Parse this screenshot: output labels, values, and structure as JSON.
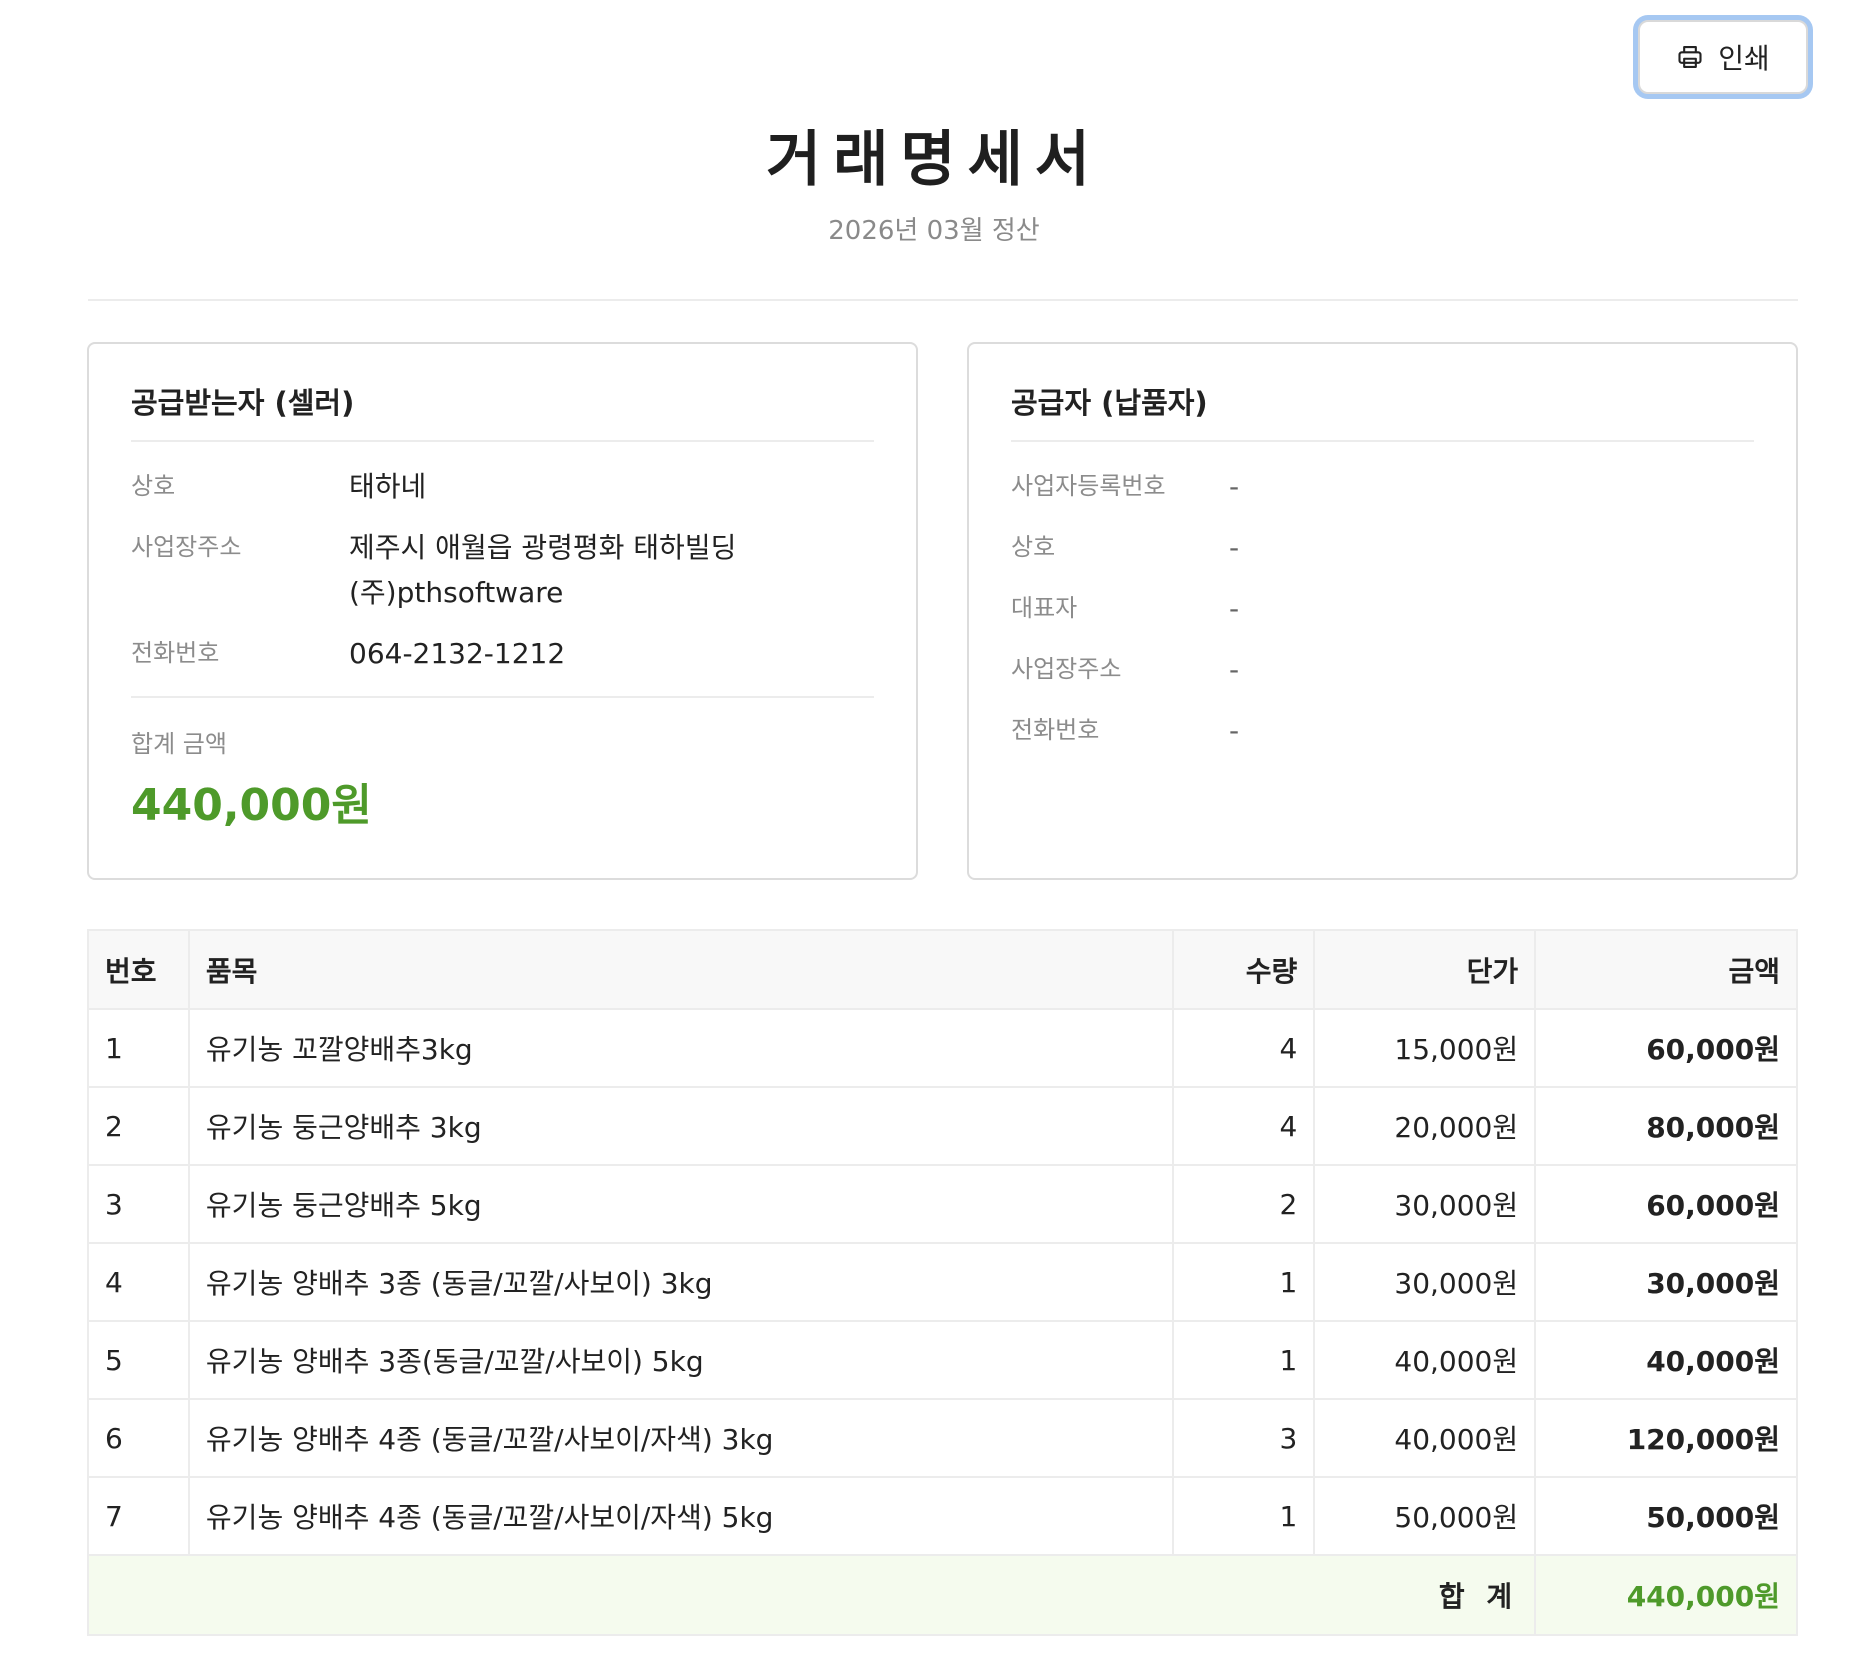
{
  "toolbar": {
    "print_label": "인쇄",
    "print_icon": "printer-icon"
  },
  "header": {
    "title": "거래명세서",
    "subtitle": "2026년 03월 정산"
  },
  "receiver": {
    "title": "공급받는자 (셀러)",
    "rows": [
      {
        "label": "상호",
        "value": "태하네"
      },
      {
        "label": "사업장주소",
        "value": "제주시 애월읍 광령평화 태하빌딩",
        "value2": "(주)pthsoftware"
      },
      {
        "label": "전화번호",
        "value": "064-2132-1212"
      }
    ],
    "total_label": "합계 금액",
    "total_amount": "440,000원"
  },
  "supplier": {
    "title": "공급자 (납품자)",
    "rows": [
      {
        "label": "사업자등록번호",
        "value": "-"
      },
      {
        "label": "상호",
        "value": "-"
      },
      {
        "label": "대표자",
        "value": "-"
      },
      {
        "label": "사업장주소",
        "value": "-"
      },
      {
        "label": "전화번호",
        "value": "-"
      }
    ]
  },
  "table": {
    "headers": [
      "번호",
      "품목",
      "수량",
      "단가",
      "금액"
    ],
    "rows": [
      {
        "no": "1",
        "item": "유기농 꼬깔양배추3kg",
        "qty": "4",
        "price": "15,000원",
        "amount": "60,000원"
      },
      {
        "no": "2",
        "item": "유기농 둥근양배추 3kg",
        "qty": "4",
        "price": "20,000원",
        "amount": "80,000원"
      },
      {
        "no": "3",
        "item": "유기농 둥근양배추 5kg",
        "qty": "2",
        "price": "30,000원",
        "amount": "60,000원"
      },
      {
        "no": "4",
        "item": "유기농 양배추 3종 (동글/꼬깔/사보이) 3kg",
        "qty": "1",
        "price": "30,000원",
        "amount": "30,000원"
      },
      {
        "no": "5",
        "item": "유기농 양배추 3종(동글/꼬깔/사보이) 5kg",
        "qty": "1",
        "price": "40,000원",
        "amount": "40,000원"
      },
      {
        "no": "6",
        "item": "유기농 양배추 4종 (동글/꼬깔/사보이/자색) 3kg",
        "qty": "3",
        "price": "40,000원",
        "amount": "120,000원"
      },
      {
        "no": "7",
        "item": "유기농 양배추 4종 (동글/꼬깔/사보이/자색) 5kg",
        "qty": "1",
        "price": "50,000원",
        "amount": "50,000원"
      }
    ],
    "total_label": "합 계",
    "total_amount": "440,000원"
  },
  "colors": {
    "accent_green": "#4e9a2a",
    "total_row_bg": "#f5fbee",
    "focus_ring": "#a6c8f2"
  }
}
